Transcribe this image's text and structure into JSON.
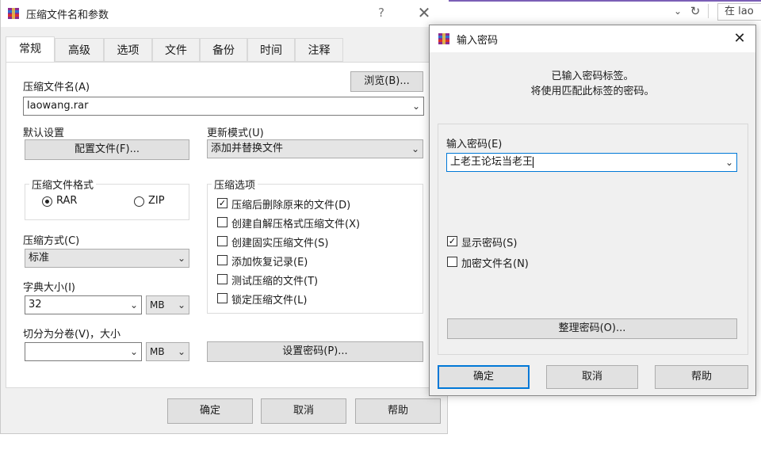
{
  "browser": {
    "search_text": "在 lao",
    "chevron_icon": "chevron-down-icon",
    "refresh_icon": "refresh-icon"
  },
  "main_dialog": {
    "title": "压缩文件名和参数",
    "help_glyph": "?",
    "close_glyph": "✕",
    "tabs": [
      {
        "label": "常规",
        "active": true
      },
      {
        "label": "高级",
        "active": false
      },
      {
        "label": "选项",
        "active": false
      },
      {
        "label": "文件",
        "active": false
      },
      {
        "label": "备份",
        "active": false
      },
      {
        "label": "时间",
        "active": false
      },
      {
        "label": "注释",
        "active": false
      }
    ],
    "archive_name_label": "压缩文件名(A)",
    "browse_button": "浏览(B)...",
    "archive_name_value": "laowang.rar",
    "default_settings_label": "默认设置",
    "profiles_button": "配置文件(F)...",
    "update_mode_label": "更新模式(U)",
    "update_mode_value": "添加并替换文件",
    "format_group_title": "压缩文件格式",
    "format_options": [
      {
        "label": "RAR",
        "selected": true
      },
      {
        "label": "ZIP",
        "selected": false
      }
    ],
    "options_group_title": "压缩选项",
    "options": [
      {
        "label": "压缩后删除原来的文件(D)",
        "checked": true
      },
      {
        "label": "创建自解压格式压缩文件(X)",
        "checked": false
      },
      {
        "label": "创建固实压缩文件(S)",
        "checked": false
      },
      {
        "label": "添加恢复记录(E)",
        "checked": false
      },
      {
        "label": "测试压缩的文件(T)",
        "checked": false
      },
      {
        "label": "锁定压缩文件(L)",
        "checked": false
      }
    ],
    "method_label": "压缩方式(C)",
    "method_value": "标准",
    "dict_label": "字典大小(I)",
    "dict_value": "32",
    "dict_unit": "MB",
    "split_label": "切分为分卷(V)，大小",
    "split_value": "",
    "split_unit": "MB",
    "set_password_button": "设置密码(P)...",
    "ok_button": "确定",
    "cancel_button": "取消",
    "help_button": "帮助",
    "check_glyph": "✓",
    "combo_arrow_glyph": "⌄"
  },
  "password_dialog": {
    "title": "输入密码",
    "close_glyph": "✕",
    "info_line1": "已输入密码标签。",
    "info_line2": "将使用匹配此标签的密码。",
    "password_label": "输入密码(E)",
    "password_value": "上老王论坛当老王",
    "show_password_label": "显示密码(S)",
    "show_password_checked": true,
    "encrypt_names_label": "加密文件名(N)",
    "encrypt_names_checked": false,
    "organize_button": "整理密码(O)...",
    "ok_button": "确定",
    "cancel_button": "取消",
    "help_button": "帮助"
  }
}
